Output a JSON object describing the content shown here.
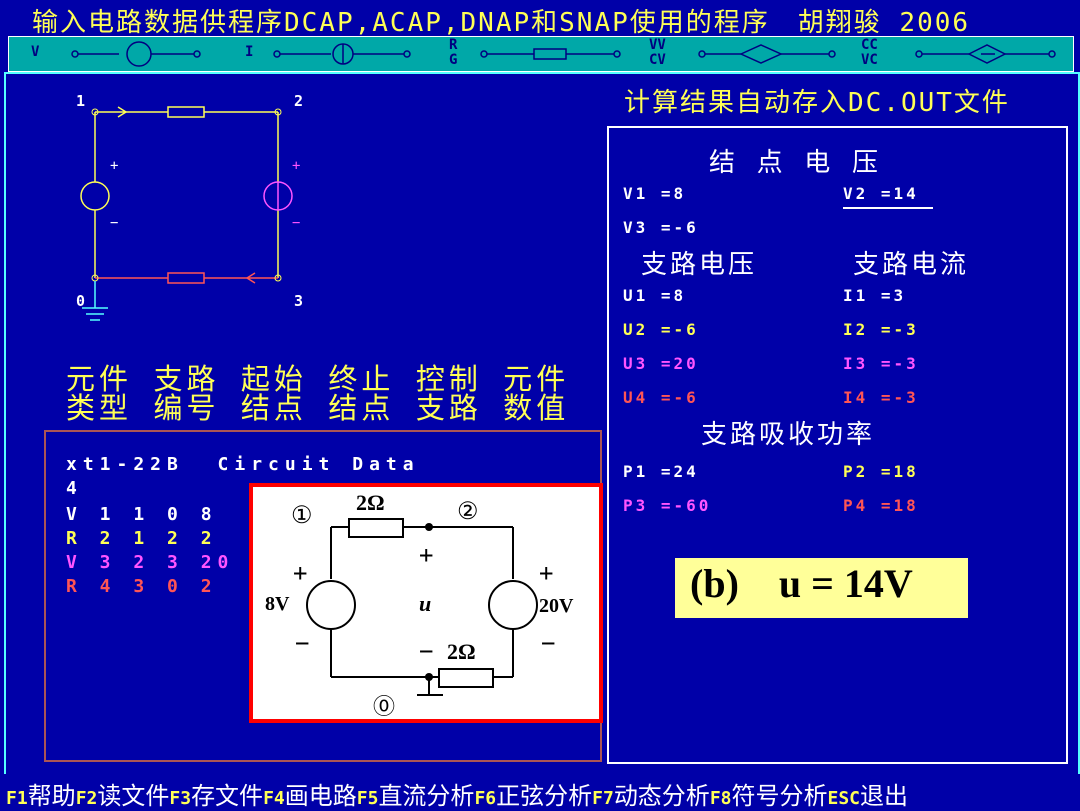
{
  "title": "输入电路数据供程序DCAP,ACAP,DNAP和SNAP使用的程序　胡翔骏 2006",
  "toolbar": {
    "items": [
      "V",
      "I",
      "R",
      "G",
      "VV",
      "CV",
      "CC",
      "VC"
    ]
  },
  "nodes": [
    "1",
    "2",
    "0",
    "3"
  ],
  "element_headers": {
    "row1": "元件 支路 起始 终止 控制 元件",
    "row2": "类型 编号 结点 结点 支路 数值"
  },
  "circuit_data": {
    "heading": "xt1-22B  Circuit Data",
    "count": "4",
    "rows": [
      "V 1 1 0 8",
      "R 2 1 2 2",
      "V 3 2 3 20",
      "R 4 3 0 2"
    ]
  },
  "inset": {
    "node1": "①",
    "node2": "②",
    "node0": "⓪",
    "r_top": "2Ω",
    "r_bottom": "2Ω",
    "src_left": "8V",
    "src_right": "20V",
    "u_label": "u",
    "plus": "+",
    "minus": "−"
  },
  "right_title": "计算结果自动存入DC.OUT文件",
  "results": {
    "node_voltage_title": "结 点 电 压",
    "v1": "V1 =8",
    "v2": "V2 =14",
    "v3": "V3 =-6",
    "branch_voltage_title": "支路电压",
    "branch_current_title": "支路电流",
    "u1": "U1 =8",
    "u2": "U2 =-6",
    "u3": "U3 =20",
    "u4": "U4 =-6",
    "i1": "I1 =3",
    "i2": "I2 =-3",
    "i3": "I3 =-3",
    "i4": "I4 =-3",
    "power_title": "支路吸收功率",
    "p1": "P1 =24",
    "p2": "P2 =18",
    "p3": "P3 =-60",
    "p4": "P4 =18"
  },
  "answer": "(b)    u = 14V",
  "function_keys": [
    {
      "key": "F1",
      "label": "帮助"
    },
    {
      "key": "F2",
      "label": "读文件"
    },
    {
      "key": "F3",
      "label": "存文件"
    },
    {
      "key": "F4",
      "label": "画电路"
    },
    {
      "key": "F5",
      "label": "直流分析"
    },
    {
      "key": "F6",
      "label": "正弦分析"
    },
    {
      "key": "F7",
      "label": "动态分析"
    },
    {
      "key": "F8",
      "label": "符号分析"
    },
    {
      "key": "ESC",
      "label": "退出"
    }
  ],
  "colors": {
    "background": "#0000a8",
    "yellow": "#ffff55",
    "magenta": "#ff55ff",
    "red": "#ff5555",
    "cyan": "#00a8a8",
    "answer_bg": "#ffff99"
  }
}
